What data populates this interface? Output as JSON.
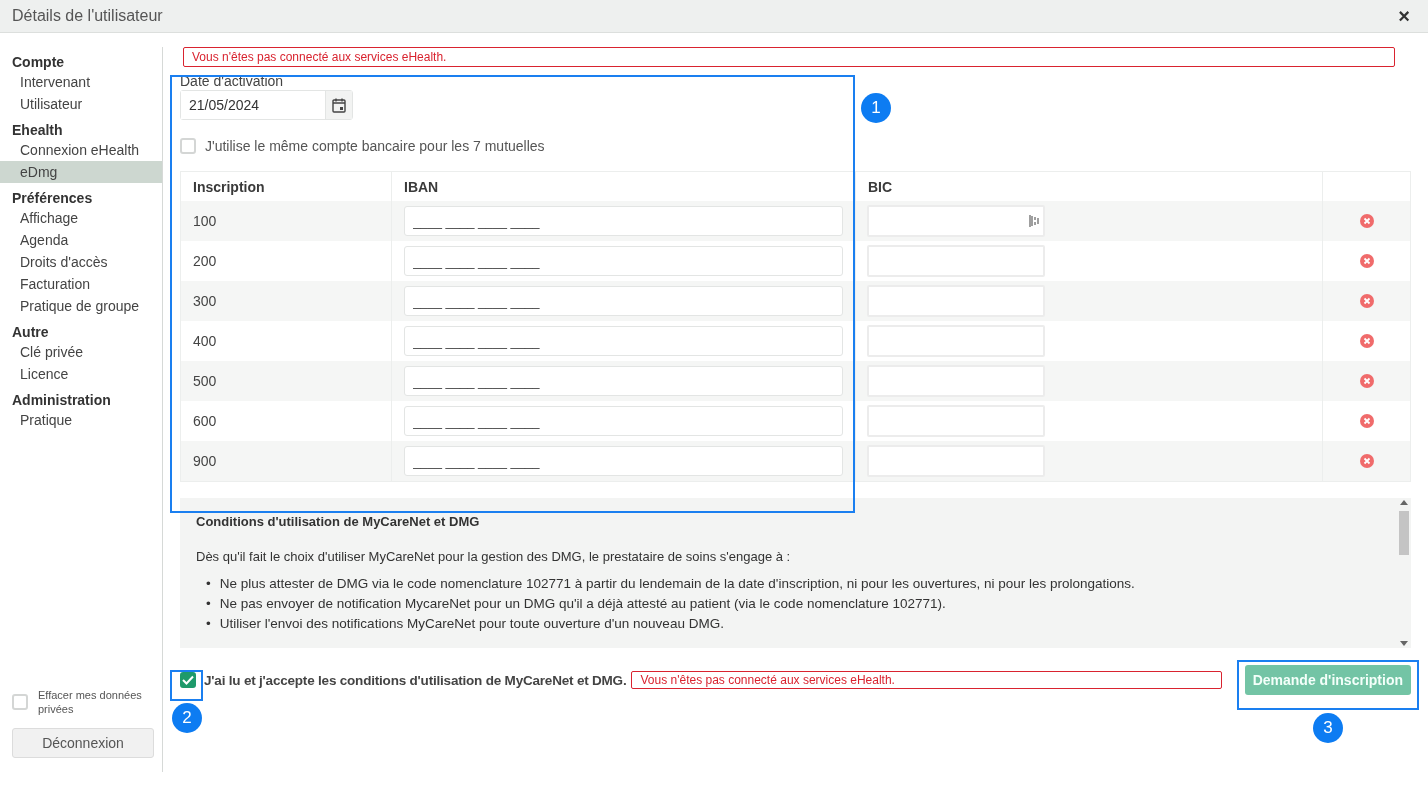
{
  "window": {
    "title": "Détails de l'utilisateur",
    "close": "×"
  },
  "sidebar": {
    "groups": [
      {
        "title": "Compte",
        "items": [
          {
            "label": "Intervenant",
            "selected": false
          },
          {
            "label": "Utilisateur",
            "selected": false
          }
        ]
      },
      {
        "title": "Ehealth",
        "items": [
          {
            "label": "Connexion eHealth",
            "selected": false
          },
          {
            "label": "eDmg",
            "selected": true
          }
        ]
      },
      {
        "title": "Préférences",
        "items": [
          {
            "label": "Affichage",
            "selected": false
          },
          {
            "label": "Agenda",
            "selected": false
          },
          {
            "label": "Droits d'accès",
            "selected": false
          },
          {
            "label": "Facturation",
            "selected": false
          },
          {
            "label": "Pratique de groupe",
            "selected": false
          }
        ]
      },
      {
        "title": "Autre",
        "items": [
          {
            "label": "Clé privée",
            "selected": false
          },
          {
            "label": "Licence",
            "selected": false
          }
        ]
      },
      {
        "title": "Administration",
        "items": [
          {
            "label": "Pratique",
            "selected": false
          }
        ]
      }
    ],
    "clear_data": {
      "label": "Effacer mes données privées",
      "checked": false
    },
    "logout_button": "Déconnexion"
  },
  "error_banner": "Vous n'êtes pas connecté aux services eHealth.",
  "activation_date": {
    "label": "Date d'activation",
    "value": "21/05/2024"
  },
  "same_account": {
    "label": "J'utilise le même compte bancaire pour les 7 mutuelles",
    "checked": false
  },
  "table": {
    "columns": [
      "Inscription",
      "IBAN",
      "BIC"
    ],
    "rows": [
      {
        "inscription": "100",
        "iban_placeholder": "____ ____ ____ ____",
        "autofill_icon": true
      },
      {
        "inscription": "200",
        "iban_placeholder": "____ ____ ____ ____",
        "autofill_icon": false
      },
      {
        "inscription": "300",
        "iban_placeholder": "____ ____ ____ ____",
        "autofill_icon": false
      },
      {
        "inscription": "400",
        "iban_placeholder": "____ ____ ____ ____",
        "autofill_icon": false
      },
      {
        "inscription": "500",
        "iban_placeholder": "____ ____ ____ ____",
        "autofill_icon": false
      },
      {
        "inscription": "600",
        "iban_placeholder": "____ ____ ____ ____",
        "autofill_icon": false
      },
      {
        "inscription": "900",
        "iban_placeholder": "____ ____ ____ ____",
        "autofill_icon": false
      }
    ]
  },
  "conditions": {
    "title": "Conditions d'utilisation de MyCareNet et DMG",
    "intro": "Dès qu'il fait le choix d'utiliser MyCareNet pour la gestion des DMG, le prestataire de soins s'engage à :",
    "items": [
      {
        "bullet": "•",
        "text": "Ne plus attester de DMG via le code nomenclature 102771 à partir du lendemain de la date d'inscription, ni pour les ouvertures, ni pour les prolongations."
      },
      {
        "bullet": "•",
        "text": "Ne pas envoyer de notification MycareNet pour un DMG qu'il a déjà attesté au patient (via le code nomenclature 102771)."
      },
      {
        "bullet": "•",
        "text": "Utiliser l'envoi des notifications MyCareNet pour toute ouverture d'un nouveau DMG."
      }
    ]
  },
  "accept": {
    "label": "J'ai lu et j'accepte les conditions d'utilisation de MyCareNet et DMG.",
    "checked": true,
    "error": "Vous n'êtes pas connecté aux services eHealth."
  },
  "submit_button": {
    "label": "Demande d'inscription",
    "disabled": true
  },
  "annotations": [
    {
      "label": "1"
    },
    {
      "label": "2"
    },
    {
      "label": "3"
    }
  ]
}
